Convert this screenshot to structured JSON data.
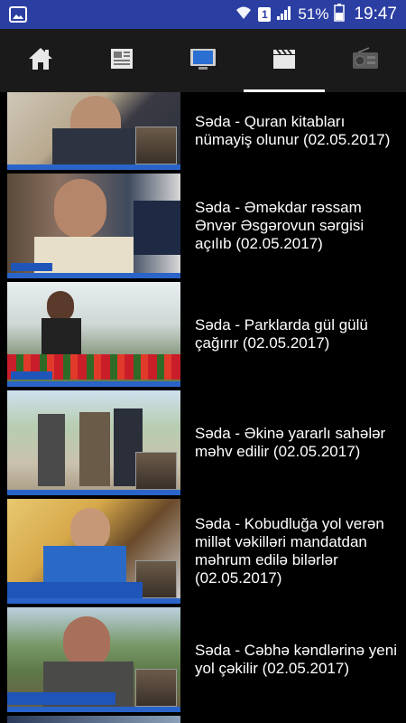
{
  "status_bar": {
    "battery": "51%",
    "time": "19:47",
    "sim": "1"
  },
  "tabs": [
    {
      "name": "home",
      "icon": "home-icon",
      "active": false
    },
    {
      "name": "news",
      "icon": "newspaper-icon",
      "active": false
    },
    {
      "name": "tv",
      "icon": "tv-icon",
      "active": false
    },
    {
      "name": "video",
      "icon": "clapperboard-icon",
      "active": true
    },
    {
      "name": "radio",
      "icon": "radio-icon",
      "active": false
    }
  ],
  "videos": [
    {
      "title": "Səda - Quran kitabları nümayiş olunur (02.05.2017)"
    },
    {
      "title": "Səda - Əməkdar rəssam Ənvər Əsgərovun sərgisi açılıb (02.05.2017)"
    },
    {
      "title": "Səda - Parklarda gül gülü çağırır (02.05.2017)"
    },
    {
      "title": "Səda - Əkinə yararlı sahələr məhv edilir (02.05.2017)"
    },
    {
      "title": "Səda - Kobudluğa yol verən millət vəkilləri mandatdan məhrum edilə bilərlər (02.05.2017)"
    },
    {
      "title": "Səda - Cəbhə kəndlərinə yeni yol çəkilir (02.05.2017)"
    }
  ]
}
